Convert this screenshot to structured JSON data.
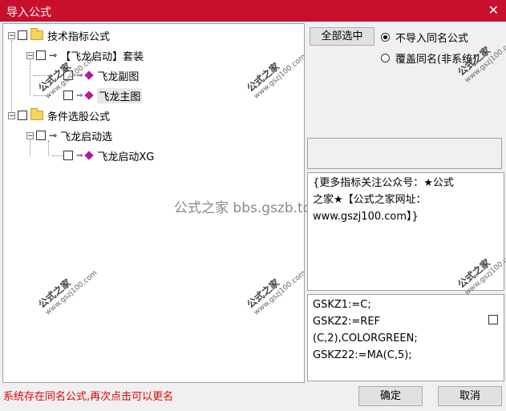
{
  "window": {
    "title": "导入公式",
    "close_glyph": "✕"
  },
  "tree": {
    "nodes": [
      {
        "label": "技术指标公式",
        "expander": "−"
      },
      {
        "label": "【飞龙启动】套装",
        "expander": "−"
      },
      {
        "label": "飞龙副图"
      },
      {
        "label": "飞龙主图"
      },
      {
        "label": "条件选股公式",
        "expander": "−"
      },
      {
        "label": "飞龙启动选",
        "expander": "−"
      },
      {
        "label": "飞龙启动XG"
      }
    ]
  },
  "controls": {
    "select_all": "全部选中",
    "radio_skip": "不导入同名公式",
    "radio_overwrite": "覆盖同名(非系统)"
  },
  "description": "{更多指标关注公众号：★公式\n之家★【公式之家网址：\nwww.gszj100.com】}",
  "code_lines": [
    "GSKZ1:=C;",
    "GSKZ2:=REF",
    "(C,2),COLORGREEN;",
    "GSKZ22:=MA(C,5);"
  ],
  "footer": {
    "status": "系统存在同名公式,再次点击可以更名",
    "ok": "确定",
    "cancel": "取消"
  },
  "watermarks": {
    "brand": "公式之家",
    "url": "www.gszj100.com",
    "center": "公式之家 bbs.gszb.top"
  }
}
